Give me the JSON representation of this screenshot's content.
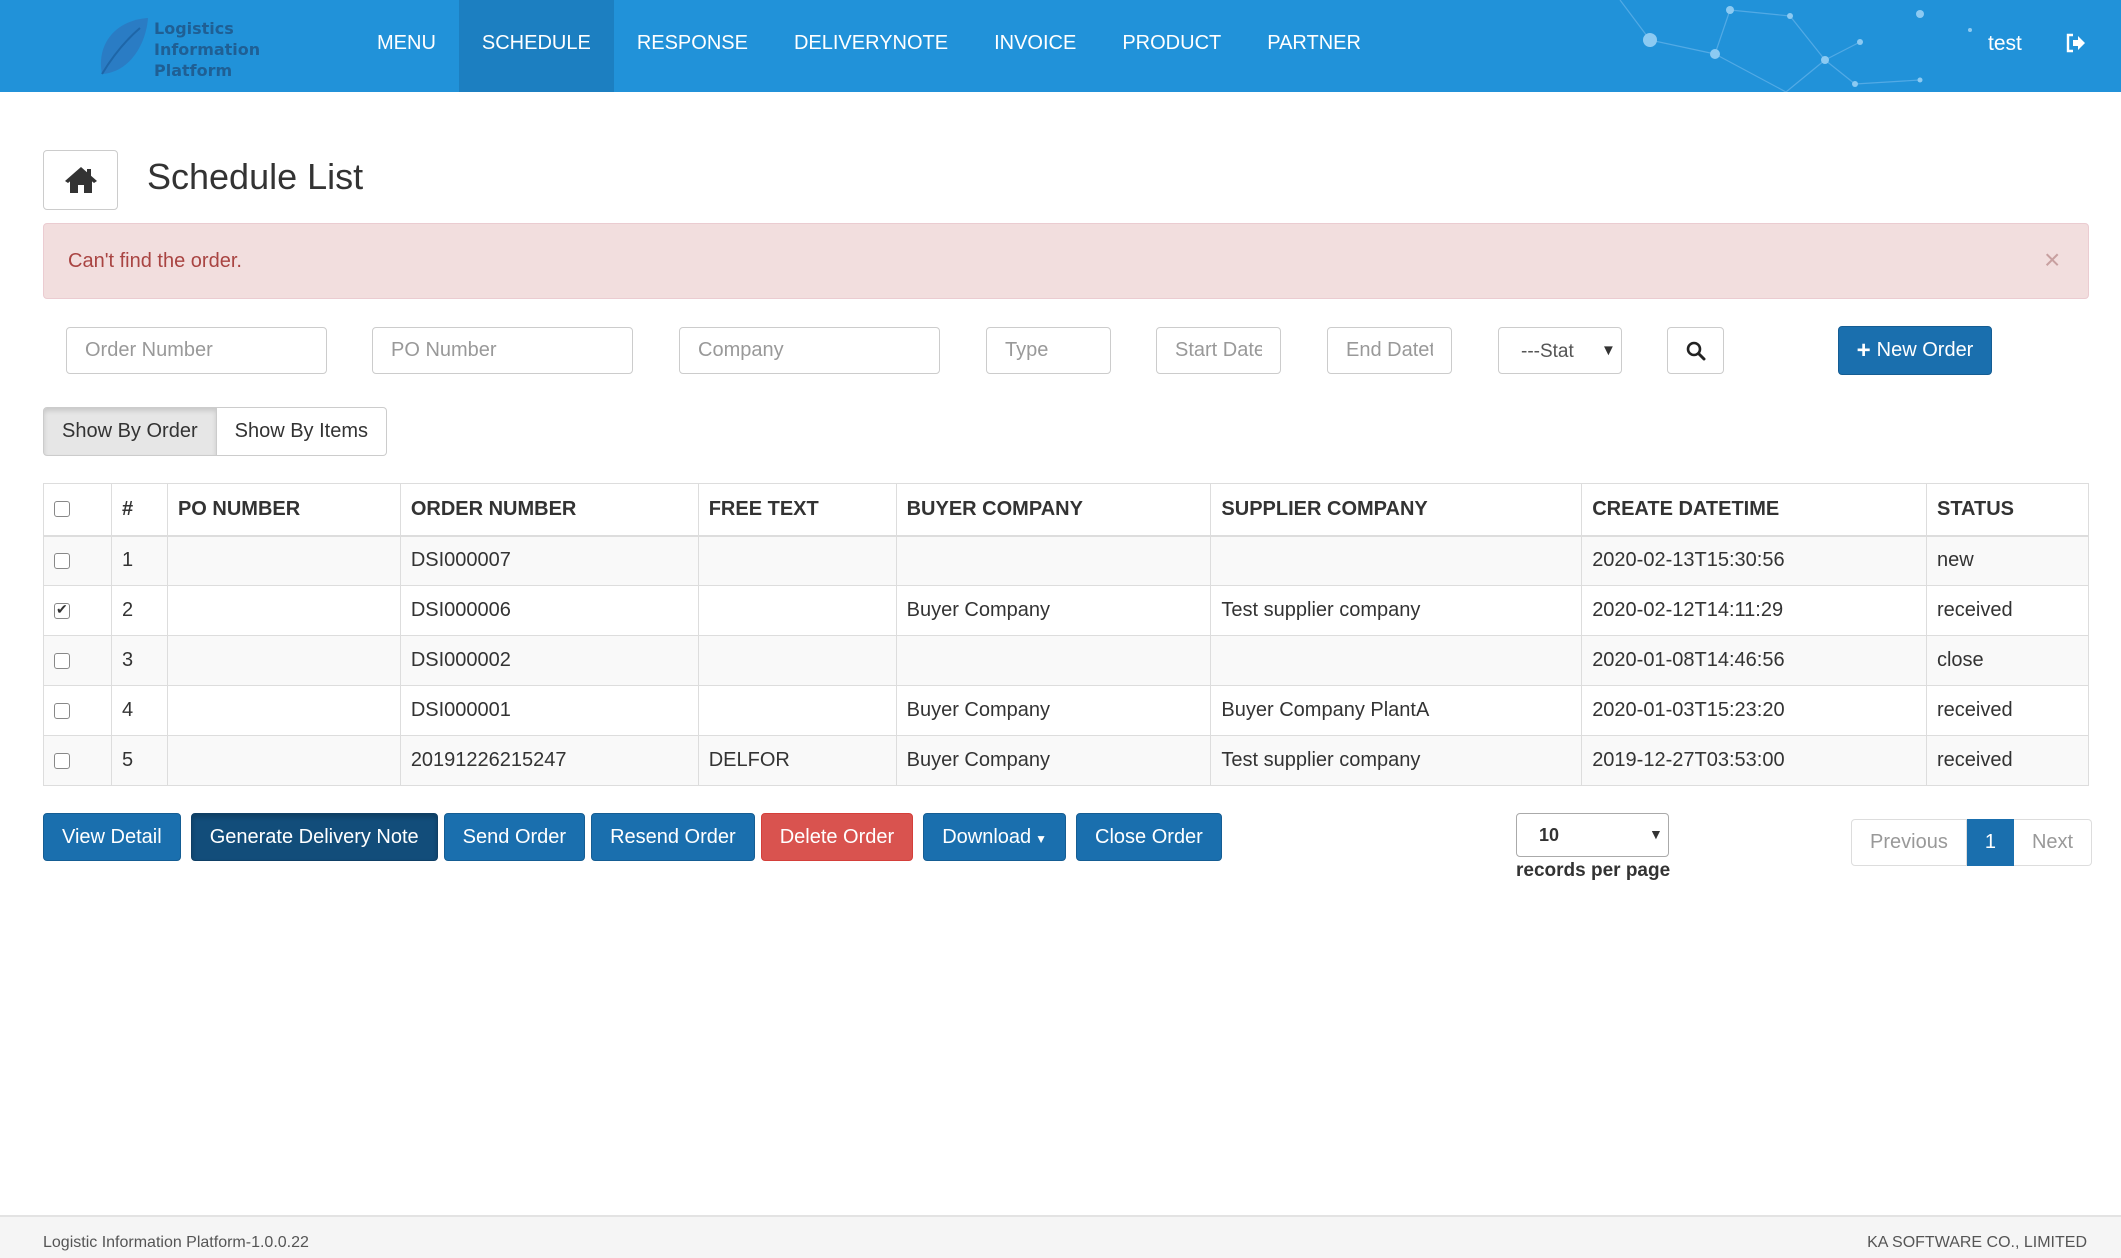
{
  "brand": {
    "line1": "Logistics",
    "line2": "Information",
    "line3": "Platform"
  },
  "nav": {
    "items": [
      {
        "label": "MENU"
      },
      {
        "label": "SCHEDULE"
      },
      {
        "label": "RESPONSE"
      },
      {
        "label": "DELIVERYNOTE"
      },
      {
        "label": "INVOICE"
      },
      {
        "label": "PRODUCT"
      },
      {
        "label": "PARTNER"
      }
    ],
    "active": "SCHEDULE",
    "user": "test"
  },
  "page": {
    "title": "Schedule List"
  },
  "alert": {
    "message": "Can't find the order.",
    "close": "×"
  },
  "filters": {
    "order_number_placeholder": "Order Number",
    "po_number_placeholder": "PO Number",
    "company_placeholder": "Company",
    "type_placeholder": "Type",
    "start_date_placeholder": "Start Date",
    "end_date_placeholder": "End Datet",
    "status_value": "---Stat",
    "new_order_label": "New Order"
  },
  "view_toggle": {
    "by_order": "Show By Order",
    "by_items": "Show By Items"
  },
  "table": {
    "headers": [
      "#",
      "PO NUMBER",
      "ORDER NUMBER",
      "FREE TEXT",
      "BUYER COMPANY",
      "SUPPLIER COMPANY",
      "CREATE DATETIME",
      "STATUS"
    ],
    "rows": [
      {
        "checked": false,
        "num": "1",
        "po": "",
        "order": "DSI000007",
        "free": "",
        "buyer": "",
        "supplier": "",
        "created": "2020-02-13T15:30:56",
        "status": "new"
      },
      {
        "checked": true,
        "num": "2",
        "po": "",
        "order": "DSI000006",
        "free": "",
        "buyer": "Buyer Company",
        "supplier": "Test supplier company",
        "created": "2020-02-12T14:11:29",
        "status": "received"
      },
      {
        "checked": false,
        "num": "3",
        "po": "",
        "order": "DSI000002",
        "free": "",
        "buyer": "",
        "supplier": "",
        "created": "2020-01-08T14:46:56",
        "status": "close"
      },
      {
        "checked": false,
        "num": "4",
        "po": "",
        "order": "DSI000001",
        "free": "",
        "buyer": "Buyer Company",
        "supplier": "Buyer Company PlantA",
        "created": "2020-01-03T15:23:20",
        "status": "received"
      },
      {
        "checked": false,
        "num": "5",
        "po": "",
        "order": "20191226215247",
        "free": "DELFOR",
        "buyer": "Buyer Company",
        "supplier": "Test supplier company",
        "created": "2019-12-27T03:53:00",
        "status": "received"
      }
    ]
  },
  "actions": {
    "view_detail": "View Detail",
    "generate_delivery_note": "Generate Delivery Note",
    "send_order": "Send Order",
    "resend_order": "Resend Order",
    "delete_order": "Delete Order",
    "download": "Download",
    "close_order": "Close Order"
  },
  "paging": {
    "page_size": "10",
    "page_size_label": "records per page",
    "previous": "Previous",
    "current": "1",
    "next": "Next"
  },
  "footer": {
    "left": "Logistic Information Platform-1.0.0.22",
    "right": "KA SOFTWARE CO., LIMITED"
  },
  "colors": {
    "primary": "#1a6fae",
    "navbar": "#2192d9",
    "danger": "#d9534f",
    "alert_bg": "#f2dede"
  }
}
